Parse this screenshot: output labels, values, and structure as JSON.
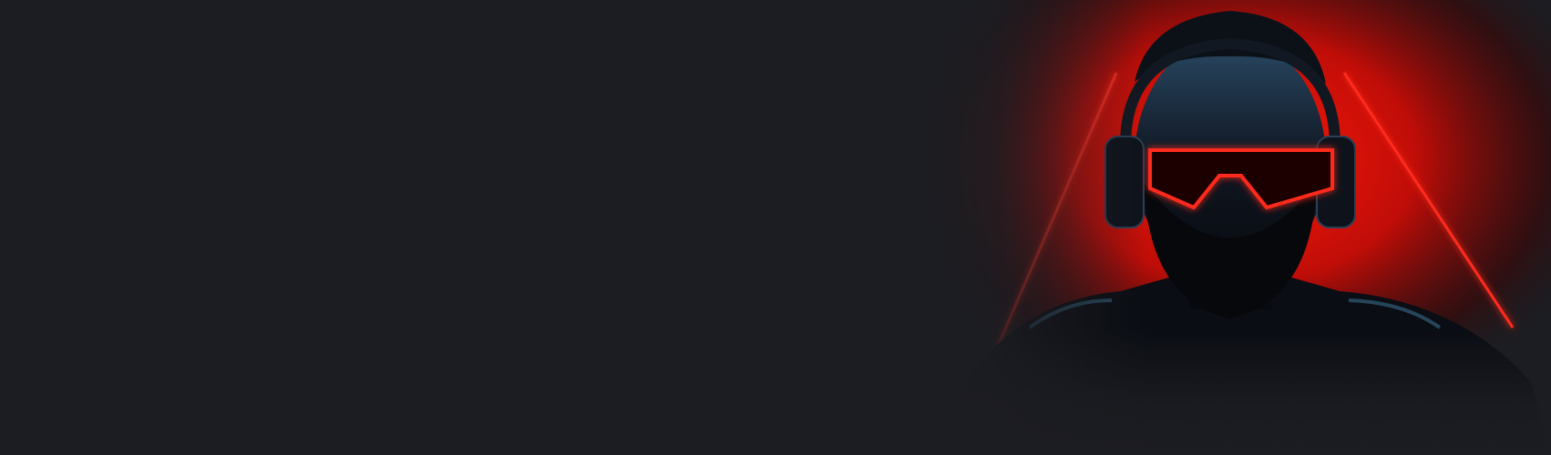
{
  "banner": {
    "background_color": "#1c1d22",
    "accent_color": "#ff2a1a",
    "art_icon": "neon-visor-avatar"
  }
}
